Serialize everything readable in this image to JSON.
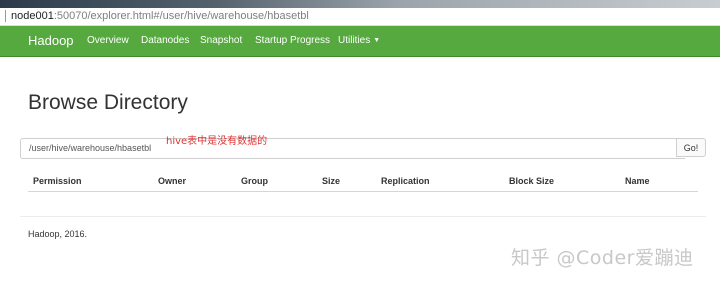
{
  "browser": {
    "url_host": "node001",
    "url_rest": ":50070/explorer.html#/user/hive/warehouse/hbasetbl"
  },
  "navbar": {
    "brand": "Hadoop",
    "items": [
      {
        "label": "Overview"
      },
      {
        "label": "Datanodes"
      },
      {
        "label": "Snapshot"
      },
      {
        "label": "Startup Progress"
      },
      {
        "label": "Utilities"
      }
    ],
    "color": "#55a93e"
  },
  "main": {
    "title": "Browse Directory",
    "path_value": "/user/hive/warehouse/hbasetbl",
    "annotation": "hive表中是没有数据的",
    "go_label": "Go!",
    "columns": [
      "Permission",
      "Owner",
      "Group",
      "Size",
      "Replication",
      "Block Size",
      "Name"
    ]
  },
  "footer": {
    "text": "Hadoop, 2016."
  },
  "watermark": "知乎 @Coder爱蹦迪"
}
